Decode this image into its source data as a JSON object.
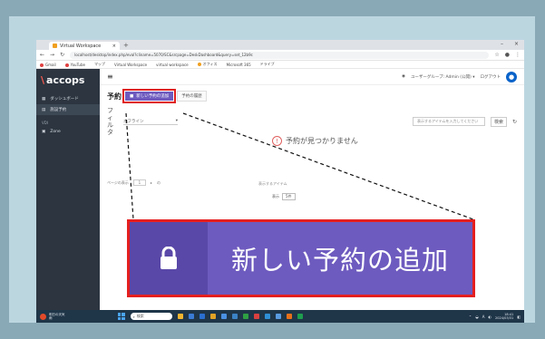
{
  "browser": {
    "tab_title": "Virtual Workspace",
    "url": "localhost/desktop/index.php/eval?cliname=5070/SC&srcpage=DeskDashboard&query=set_12b9c",
    "bookmarks": [
      "Gmail",
      "YouTube",
      "マップ",
      "Virtual Workspace",
      "virtual workspace",
      "オフィス",
      "Microsoft 365",
      "ドライブ"
    ]
  },
  "app": {
    "logo": "accops",
    "sidebar": {
      "items": [
        {
          "label": "ダッシュボード",
          "icon": "dashboard-icon"
        },
        {
          "label": "施設予約",
          "icon": "calendar-icon"
        }
      ],
      "section_label": "VDI",
      "section_items": [
        {
          "label": "Zone",
          "icon": "grid-icon"
        }
      ]
    },
    "topbar": {
      "user_label": "ユーザーグループ: Admin (公開) ▾",
      "logout_label": "ログアウト"
    },
    "page_title": "予約",
    "add_button_label": "新しい予約の追加",
    "history_button_label": "予約の履歴",
    "filter_label": "フィルタ",
    "filter_select_value": "オフライン",
    "search_placeholder": "表示するアイテムを入力してください",
    "search_button_label": "検索",
    "empty_message": "予約が見つかりません",
    "pager": {
      "prefix": "ページの表示",
      "page_value": "1",
      "suffix": "の"
    },
    "items_text": "表示するアイテム",
    "perpage_label": "表示",
    "perpage_value": "5件"
  },
  "taskbar": {
    "weather_line1": "明日の天気",
    "weather_line2": "雨",
    "search_placeholder": "検索",
    "tray_lang": "A",
    "clock_time": "18:41",
    "clock_date": "2024/03/31"
  },
  "callout": {
    "text": "新しい予約の追加",
    "icon": "lock-icon"
  },
  "colors": {
    "accent": "#6e5bbf",
    "highlight": "#e51f1f",
    "sidebar": "#2c3540"
  }
}
